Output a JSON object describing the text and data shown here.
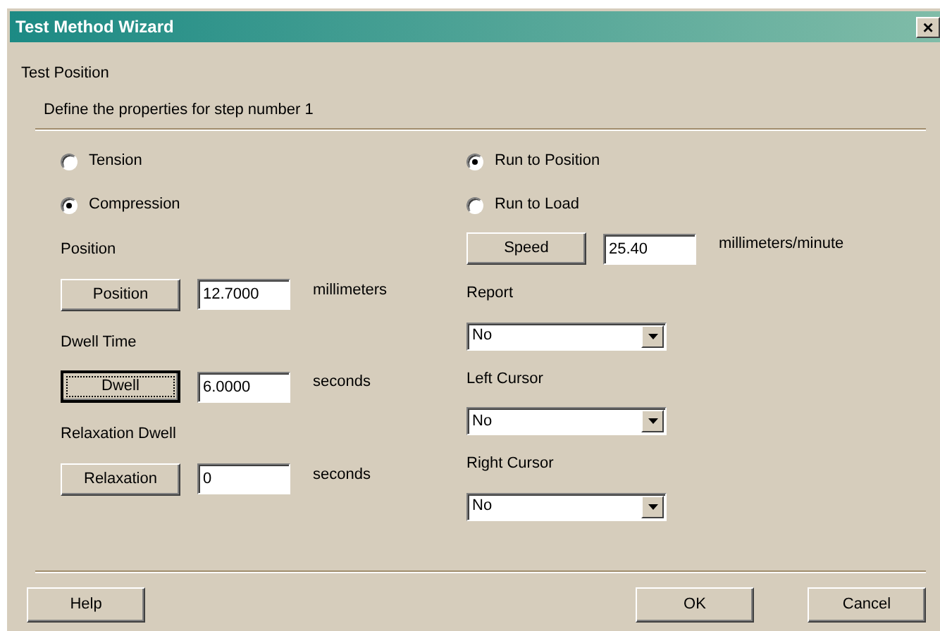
{
  "window": {
    "title": "Test Method Wizard",
    "close": "×"
  },
  "header": {
    "title": "Test Position",
    "subtitle": "Define the properties for step number 1"
  },
  "mode_options": [
    {
      "label": "Tension",
      "selected": false
    },
    {
      "label": "Compression",
      "selected": true
    }
  ],
  "left_fields": [
    {
      "heading": "Position",
      "button": "Position",
      "value": "12.7000",
      "unit": "millimeters",
      "focused": false
    },
    {
      "heading": "Dwell Time",
      "button": "Dwell",
      "value": "6.0000",
      "unit": "seconds",
      "focused": true
    },
    {
      "heading": "Relaxation Dwell",
      "button": "Relaxation",
      "value": "0",
      "unit": "seconds",
      "focused": false
    }
  ],
  "run_options": [
    {
      "label": "Run to Position",
      "selected": true
    },
    {
      "label": "Run to Load",
      "selected": false
    }
  ],
  "speed": {
    "button": "Speed",
    "value": "25.40",
    "unit": "millimeters/minute"
  },
  "dropdowns": [
    {
      "label": "Report",
      "value": "No"
    },
    {
      "label": "Left Cursor",
      "value": "No"
    },
    {
      "label": "Right Cursor",
      "value": "No"
    }
  ],
  "help_button": {
    "label": "Help"
  },
  "dialog_buttons": [
    {
      "label": "OK"
    },
    {
      "label": "Cancel"
    }
  ]
}
